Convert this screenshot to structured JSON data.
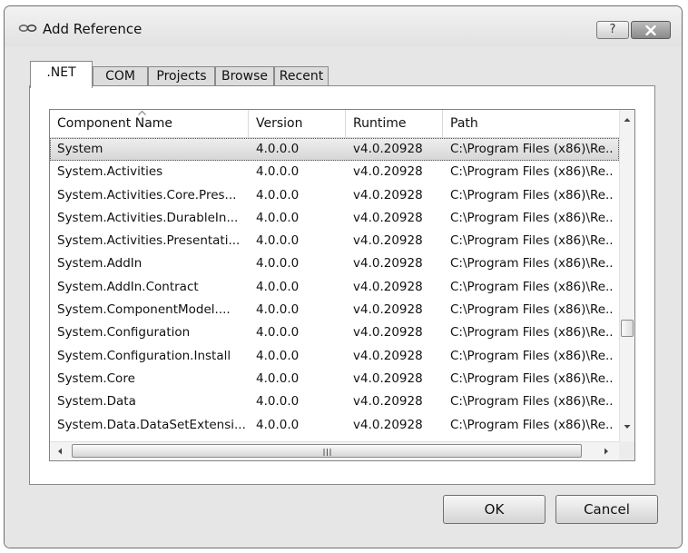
{
  "window": {
    "title": "Add Reference",
    "help_label": "?"
  },
  "tabs": [
    {
      "label": ".NET",
      "active": true
    },
    {
      "label": "COM",
      "active": false
    },
    {
      "label": "Projects",
      "active": false
    },
    {
      "label": "Browse",
      "active": false
    },
    {
      "label": "Recent",
      "active": false
    }
  ],
  "list": {
    "columns": [
      "Component Name",
      "Version",
      "Runtime",
      "Path"
    ],
    "sorted_column": "Component Name",
    "rows": [
      {
        "name": "System",
        "version": "4.0.0.0",
        "runtime": "v4.0.20928",
        "path": "C:\\Program Files (x86)\\Re..",
        "selected": true
      },
      {
        "name": "System.Activities",
        "version": "4.0.0.0",
        "runtime": "v4.0.20928",
        "path": "C:\\Program Files (x86)\\Re..",
        "selected": false
      },
      {
        "name": "System.Activities.Core.Pres...",
        "version": "4.0.0.0",
        "runtime": "v4.0.20928",
        "path": "C:\\Program Files (x86)\\Re..",
        "selected": false
      },
      {
        "name": "System.Activities.DurableIn...",
        "version": "4.0.0.0",
        "runtime": "v4.0.20928",
        "path": "C:\\Program Files (x86)\\Re..",
        "selected": false
      },
      {
        "name": "System.Activities.Presentati...",
        "version": "4.0.0.0",
        "runtime": "v4.0.20928",
        "path": "C:\\Program Files (x86)\\Re..",
        "selected": false
      },
      {
        "name": "System.AddIn",
        "version": "4.0.0.0",
        "runtime": "v4.0.20928",
        "path": "C:\\Program Files (x86)\\Re..",
        "selected": false
      },
      {
        "name": "System.AddIn.Contract",
        "version": "4.0.0.0",
        "runtime": "v4.0.20928",
        "path": "C:\\Program Files (x86)\\Re..",
        "selected": false
      },
      {
        "name": "System.ComponentModel....",
        "version": "4.0.0.0",
        "runtime": "v4.0.20928",
        "path": "C:\\Program Files (x86)\\Re..",
        "selected": false
      },
      {
        "name": "System.Configuration",
        "version": "4.0.0.0",
        "runtime": "v4.0.20928",
        "path": "C:\\Program Files (x86)\\Re..",
        "selected": false
      },
      {
        "name": "System.Configuration.Install",
        "version": "4.0.0.0",
        "runtime": "v4.0.20928",
        "path": "C:\\Program Files (x86)\\Re..",
        "selected": false
      },
      {
        "name": "System.Core",
        "version": "4.0.0.0",
        "runtime": "v4.0.20928",
        "path": "C:\\Program Files (x86)\\Re..",
        "selected": false
      },
      {
        "name": "System.Data",
        "version": "4.0.0.0",
        "runtime": "v4.0.20928",
        "path": "C:\\Program Files (x86)\\Re..",
        "selected": false
      },
      {
        "name": "System.Data.DataSetExtensi...",
        "version": "4.0.0.0",
        "runtime": "v4.0.20928",
        "path": "C:\\Program Files (x86)\\Re..",
        "selected": false
      }
    ]
  },
  "buttons": {
    "ok": "OK",
    "cancel": "Cancel"
  },
  "icons": {
    "title": "reference-link-icon",
    "close": "close-icon",
    "sort": "sort-ascending-icon"
  }
}
